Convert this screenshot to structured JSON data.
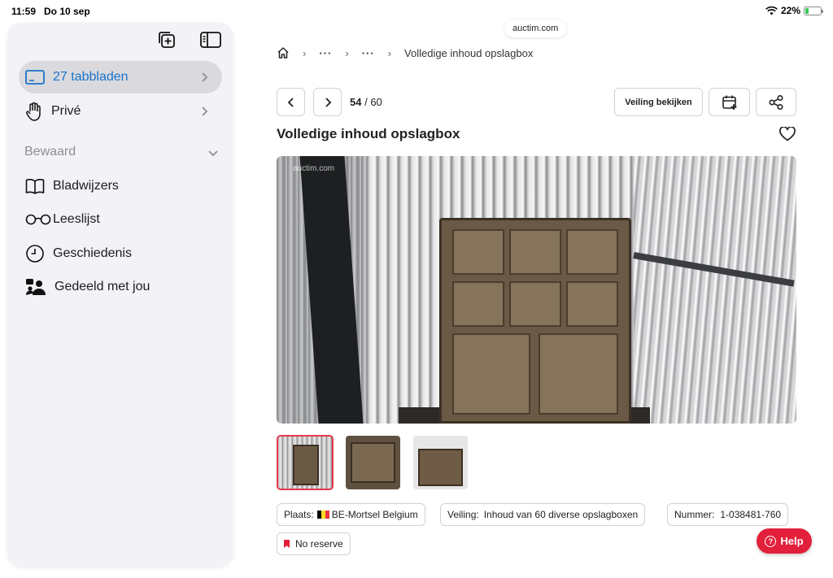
{
  "status_bar": {
    "time": "11:59",
    "date": "Do 10 sep",
    "battery": "22%",
    "battery_level": 0.22
  },
  "sidebar": {
    "items": [
      {
        "label": "27 tabbladen",
        "icon": "tabs-icon",
        "active": true
      },
      {
        "label": "Privé",
        "icon": "hand-icon"
      }
    ],
    "section_label": "Bewaard",
    "saved_items": [
      {
        "label": "Bladwijzers",
        "icon": "book-icon"
      },
      {
        "label": "Leeslijst",
        "icon": "glasses-icon"
      },
      {
        "label": "Geschiedenis",
        "icon": "clock-icon"
      },
      {
        "label": "Gedeeld met jou",
        "icon": "shared-people-icon"
      }
    ]
  },
  "browser": {
    "url": "auctim.com"
  },
  "breadcrumb": {
    "ellipsis_1": "···",
    "ellipsis_2": "···",
    "current": "Volledige inhoud opslagbox"
  },
  "pager": {
    "current": "54",
    "separator": " / ",
    "total": "60"
  },
  "actions": {
    "view_auction": "Veiling bekijken"
  },
  "listing": {
    "title": "Volledige inhoud opslagbox",
    "watermark": "auctim.com",
    "location_label": "Plaats:",
    "location_value": "BE-Mortsel Belgium",
    "auction_label": "Veiling:",
    "auction_value": "Inhoud van 60 diverse opslagboxen",
    "number_label": "Nummer:",
    "number_value": "1-038481-760",
    "reserve": "No reserve"
  },
  "help": {
    "label": "Help"
  },
  "colors": {
    "accent": "#1a73c9",
    "brand_red": "#e3203b",
    "battery_green": "#34c759"
  }
}
